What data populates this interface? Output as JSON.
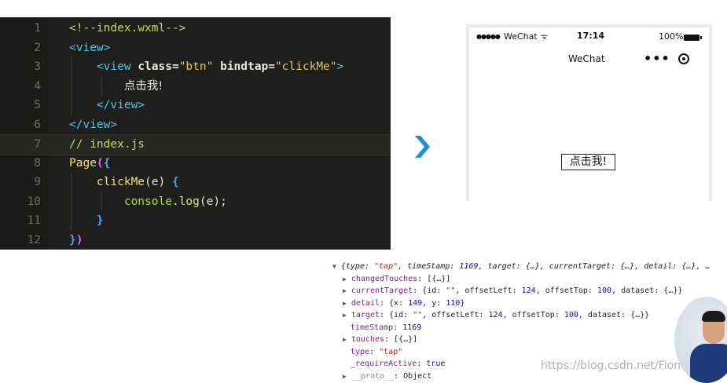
{
  "editor": {
    "lines": [
      {
        "n": "1",
        "parts": [
          {
            "c": "c-comment",
            "t": "<!--index.wxml-->"
          }
        ]
      },
      {
        "n": "2",
        "parts": [
          {
            "c": "c-tag",
            "t": "<view>"
          }
        ]
      },
      {
        "n": "3",
        "parts": [
          {
            "c": "c-plain",
            "t": "    "
          },
          {
            "c": "c-tag",
            "t": "<view "
          },
          {
            "c": "c-attr",
            "t": "class="
          },
          {
            "c": "c-str",
            "t": "\"btn\" "
          },
          {
            "c": "c-attr",
            "t": "bindtap="
          },
          {
            "c": "c-str",
            "t": "\"clickMe\""
          },
          {
            "c": "c-tag",
            "t": ">"
          }
        ]
      },
      {
        "n": "4",
        "parts": [
          {
            "c": "c-plain",
            "t": "        "
          },
          {
            "c": "c-text",
            "t": "点击我!"
          }
        ]
      },
      {
        "n": "5",
        "parts": [
          {
            "c": "c-plain",
            "t": "    "
          },
          {
            "c": "c-tag",
            "t": "</view>"
          }
        ]
      },
      {
        "n": "6",
        "parts": [
          {
            "c": "c-tag",
            "t": "</view>"
          }
        ]
      },
      {
        "n": "7",
        "parts": [
          {
            "c": "c-comment",
            "t": "// index.js"
          }
        ]
      },
      {
        "n": "8",
        "parts": [
          {
            "c": "c-fn",
            "t": "Page"
          },
          {
            "c": "c-brace1",
            "t": "("
          },
          {
            "c": "c-brace2",
            "t": "{"
          }
        ]
      },
      {
        "n": "9",
        "parts": [
          {
            "c": "c-plain",
            "t": "    "
          },
          {
            "c": "c-fn",
            "t": "clickMe"
          },
          {
            "c": "c-plain",
            "t": "(e) "
          },
          {
            "c": "c-brace2",
            "t": "{"
          }
        ]
      },
      {
        "n": "10",
        "parts": [
          {
            "c": "c-plain",
            "t": "        "
          },
          {
            "c": "c-obj",
            "t": "console"
          },
          {
            "c": "c-plain",
            "t": "."
          },
          {
            "c": "c-method",
            "t": "log"
          },
          {
            "c": "c-plain",
            "t": "(e);"
          }
        ]
      },
      {
        "n": "11",
        "parts": [
          {
            "c": "c-plain",
            "t": "    "
          },
          {
            "c": "c-brace2",
            "t": "}"
          }
        ]
      },
      {
        "n": "12",
        "parts": [
          {
            "c": "c-brace2",
            "t": "}"
          },
          {
            "c": "c-brace1",
            "t": ")"
          }
        ]
      }
    ],
    "highlighted_line": "7"
  },
  "phone": {
    "signal": "●●●●●",
    "carrier": "WeChat",
    "wifi": "ᯤ",
    "clock": "17:14",
    "battery_pct": "100%",
    "nav_title": "WeChat",
    "nav_more": "•••",
    "button_label": "点击我!"
  },
  "console": {
    "lines": [
      {
        "indent": 0,
        "tri": "▼",
        "parts": [
          {
            "c": "it",
            "t": "{type: "
          },
          {
            "c": "it s",
            "t": "\"tap\""
          },
          {
            "c": "it",
            "t": ", timeStamp: "
          },
          {
            "c": "it n",
            "t": "1169"
          },
          {
            "c": "it",
            "t": ", target: {…}, currentTarget: {…}, detail: {…}, …"
          }
        ]
      },
      {
        "indent": 1,
        "tri": "▶",
        "parts": [
          {
            "c": "k",
            "t": "changedTouches"
          },
          {
            "c": "",
            "t": ": [{…}]"
          }
        ]
      },
      {
        "indent": 1,
        "tri": "▶",
        "parts": [
          {
            "c": "k",
            "t": "currentTarget"
          },
          {
            "c": "",
            "t": ": {id: "
          },
          {
            "c": "s",
            "t": "\"\""
          },
          {
            "c": "",
            "t": ", offsetLeft: "
          },
          {
            "c": "n",
            "t": "124"
          },
          {
            "c": "",
            "t": ", offsetTop: "
          },
          {
            "c": "n",
            "t": "100"
          },
          {
            "c": "",
            "t": ", dataset: {…}}"
          }
        ]
      },
      {
        "indent": 1,
        "tri": "▶",
        "parts": [
          {
            "c": "k",
            "t": "detail"
          },
          {
            "c": "",
            "t": ": {x: "
          },
          {
            "c": "n",
            "t": "149"
          },
          {
            "c": "",
            "t": ", y: "
          },
          {
            "c": "n",
            "t": "110"
          },
          {
            "c": "",
            "t": "}"
          }
        ]
      },
      {
        "indent": 1,
        "tri": "▶",
        "parts": [
          {
            "c": "k",
            "t": "target"
          },
          {
            "c": "",
            "t": ": {id: "
          },
          {
            "c": "s",
            "t": "\"\""
          },
          {
            "c": "",
            "t": ", offsetLeft: "
          },
          {
            "c": "n",
            "t": "124"
          },
          {
            "c": "",
            "t": ", offsetTop: "
          },
          {
            "c": "n",
            "t": "100"
          },
          {
            "c": "",
            "t": ", dataset: {…}}"
          }
        ]
      },
      {
        "indent": 2,
        "tri": "",
        "parts": [
          {
            "c": "k",
            "t": "timeStamp"
          },
          {
            "c": "",
            "t": ": "
          },
          {
            "c": "n",
            "t": "1169"
          }
        ]
      },
      {
        "indent": 1,
        "tri": "▶",
        "parts": [
          {
            "c": "k",
            "t": "touches"
          },
          {
            "c": "",
            "t": ": [{…}]"
          }
        ]
      },
      {
        "indent": 2,
        "tri": "",
        "parts": [
          {
            "c": "k",
            "t": "type"
          },
          {
            "c": "",
            "t": ": "
          },
          {
            "c": "s",
            "t": "\"tap\""
          }
        ]
      },
      {
        "indent": 2,
        "tri": "",
        "parts": [
          {
            "c": "k",
            "t": "_requireActive"
          },
          {
            "c": "",
            "t": ": "
          },
          {
            "c": "n",
            "t": "true"
          }
        ]
      },
      {
        "indent": 1,
        "tri": "▶",
        "parts": [
          {
            "c": "k muted",
            "t": "__proto__"
          },
          {
            "c": "",
            "t": ": Object"
          }
        ]
      }
    ]
  },
  "watermark": "https://blog.csdn.net/Fionapiupiu",
  "colors": {
    "editor_bg": "#1e1f1c",
    "arrow": "#1e8fd6",
    "console_key": "#871a8f",
    "console_string": "#c41a16",
    "console_number": "#1c00cf"
  }
}
